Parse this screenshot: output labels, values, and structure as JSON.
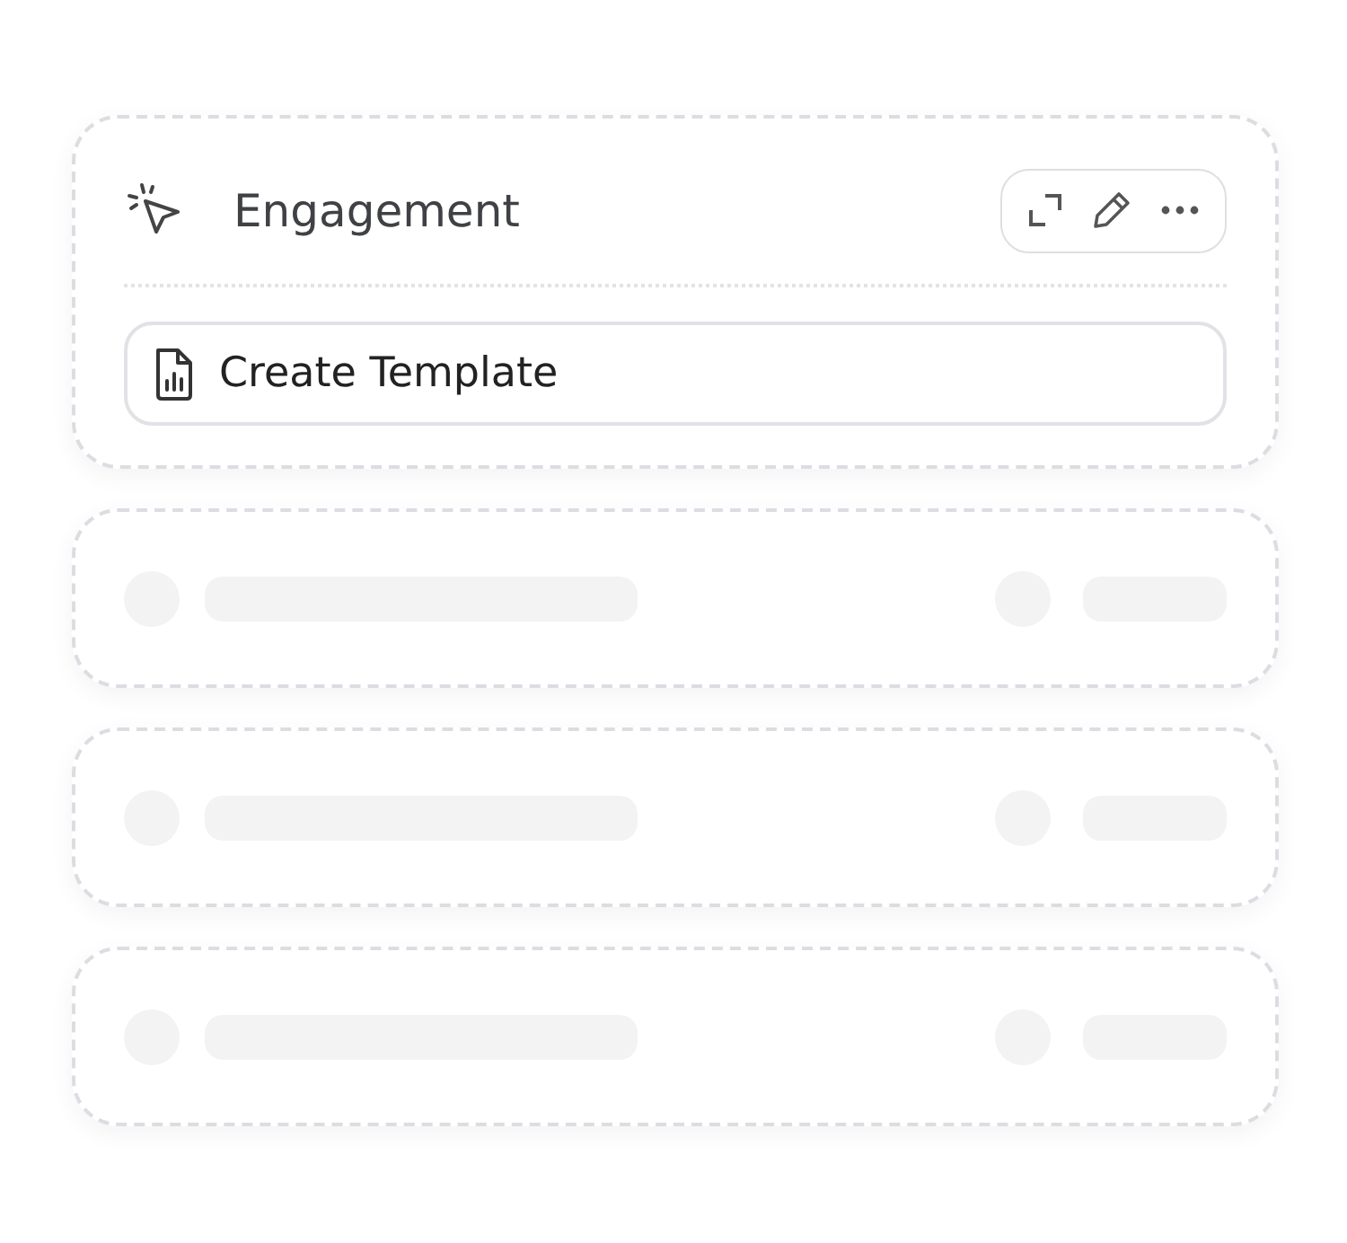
{
  "widget": {
    "title": "Engagement",
    "action": {
      "label": "Create Template"
    }
  },
  "placeholder_rows": [
    {
      "kind": "skeleton"
    },
    {
      "kind": "skeleton"
    },
    {
      "kind": "skeleton"
    }
  ]
}
